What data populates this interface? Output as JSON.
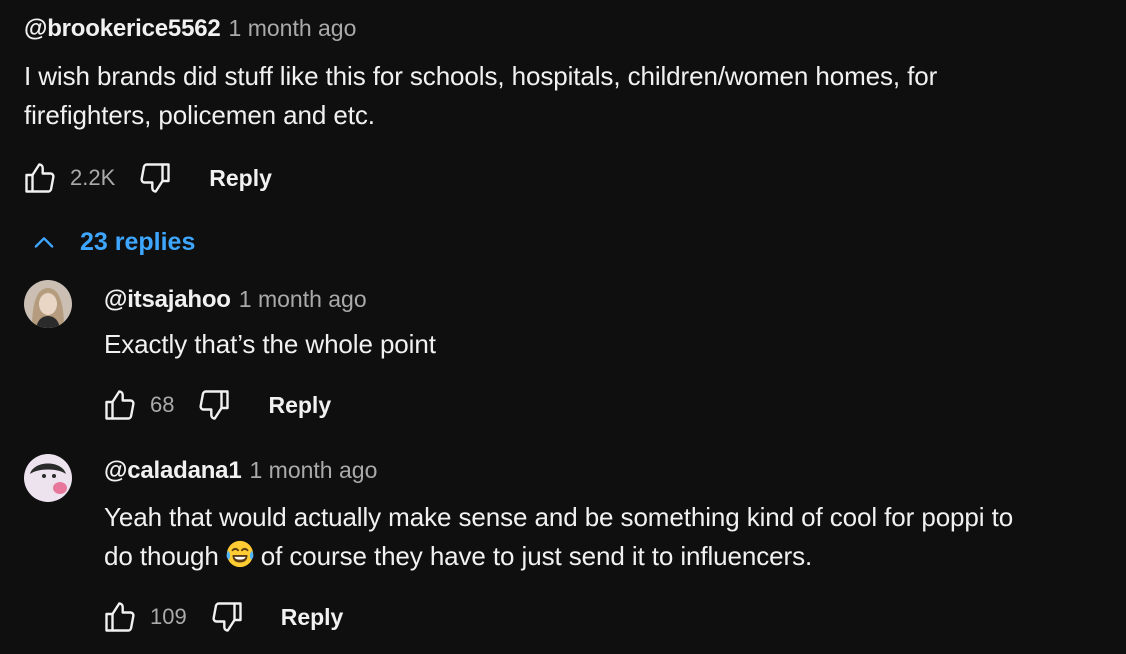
{
  "comment": {
    "author": "@brookerice5562",
    "time": "1 month ago",
    "text_line1": "I wish brands did stuff like this for schools, hospitals, children/women homes, for",
    "text_line2": "firefighters, policemen and etc.",
    "like_count": "2.2K",
    "reply_label": "Reply",
    "replies_label": "23 replies",
    "replies_icon": "chevron-up-icon"
  },
  "replies": [
    {
      "author": "@itsajahoo",
      "time": "1 month ago",
      "text_line1": "Exactly that’s the whole point",
      "like_count": "68",
      "reply_label": "Reply"
    },
    {
      "author": "@caladana1",
      "time": "1 month ago",
      "text_line1": "Yeah that would actually make sense and be something kind of cool for poppi to",
      "text_line2_before_emoji": "do though",
      "text_line2_after_emoji": "of course they have to just send it to influencers.",
      "emoji": "face-with-tears-of-joy-icon",
      "like_count": "109",
      "reply_label": "Reply"
    }
  ],
  "colors": {
    "background": "#0f0f0f",
    "text": "#f1f1f1",
    "secondary_text": "#aaaaaa",
    "link": "#3ea6ff"
  }
}
